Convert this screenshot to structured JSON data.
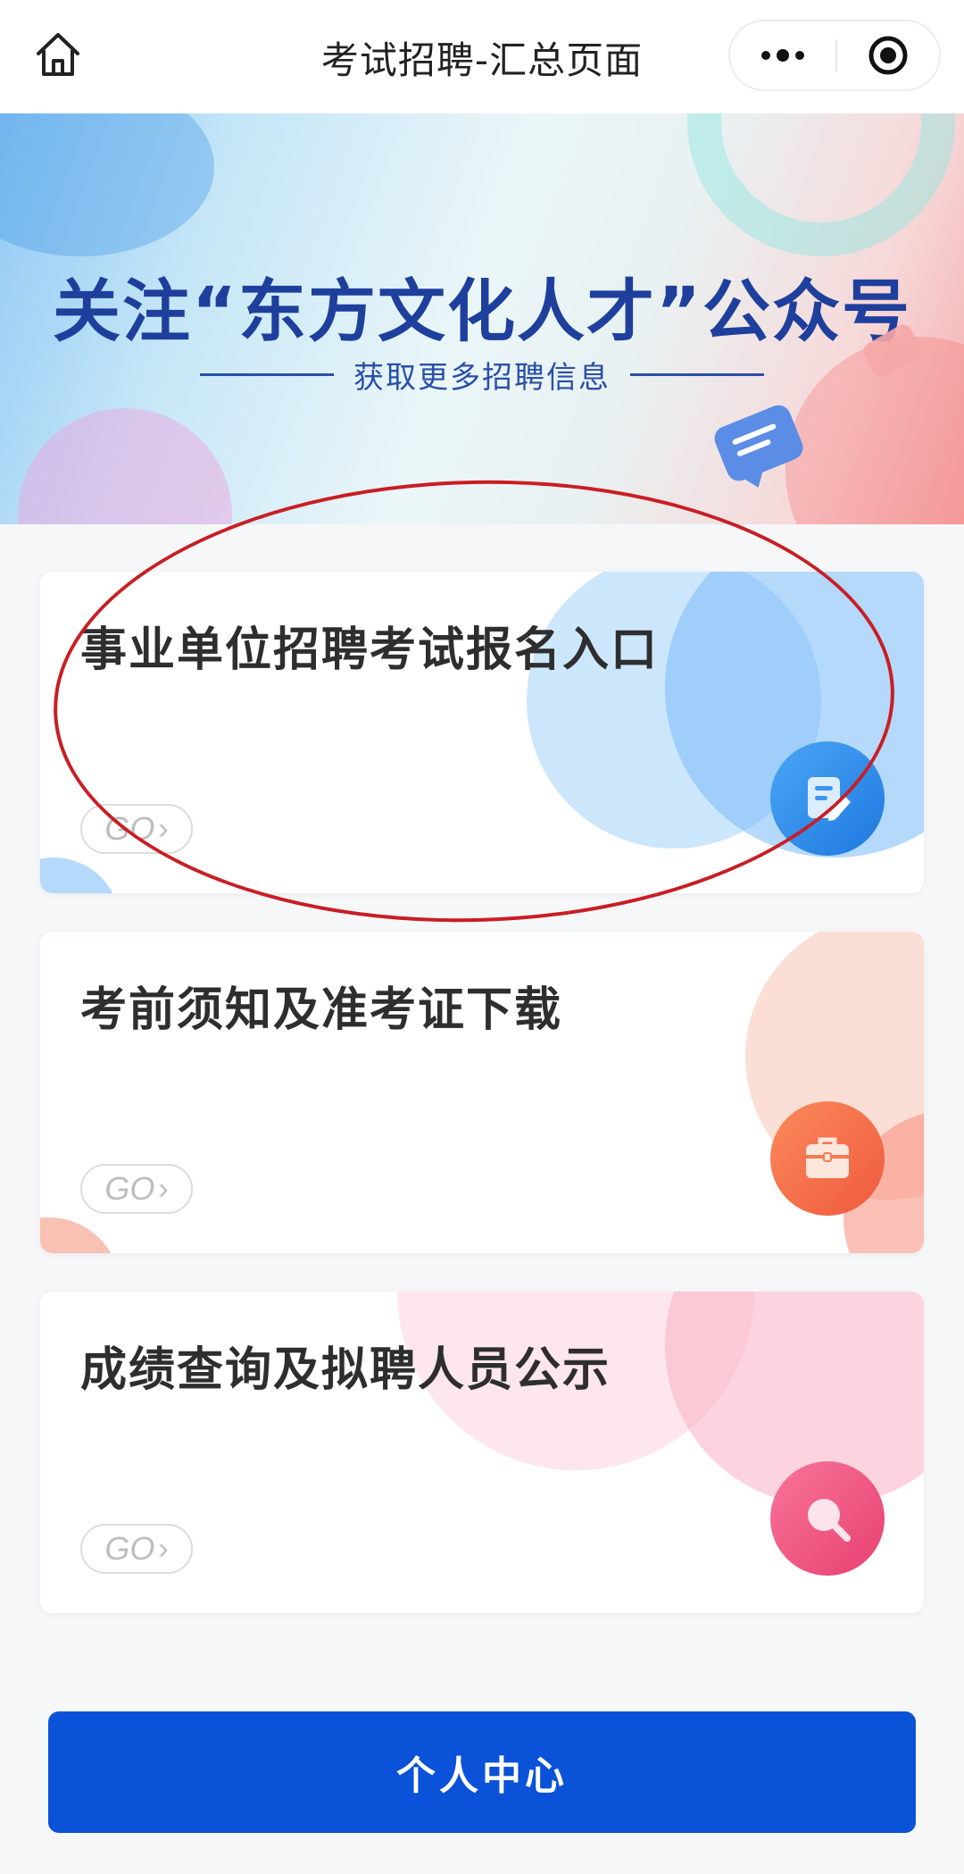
{
  "navbar": {
    "title": "考试招聘-汇总页面",
    "home_icon": "home-icon",
    "more_icon": "more-dots-icon",
    "target_icon": "target-circle-icon"
  },
  "banner": {
    "title": "关注“东方文化人才”公众号",
    "subtitle": "获取更多招聘信息"
  },
  "cards": [
    {
      "title": "事业单位招聘考试报名入口",
      "go_label": "GO",
      "icon": "edit-document-icon",
      "accent": "#3d93f0"
    },
    {
      "title": "考前须知及准考证下载",
      "go_label": "GO",
      "icon": "briefcase-icon",
      "accent": "#f57a53"
    },
    {
      "title": "成绩查询及拟聘人员公示",
      "go_label": "GO",
      "icon": "search-icon",
      "accent": "#ee5b87"
    }
  ],
  "footer": {
    "button_label": "个人中心"
  },
  "colors": {
    "primary_button": "#0a52d8",
    "banner_text": "#1f3f9d",
    "annotation": "#c81e24"
  }
}
